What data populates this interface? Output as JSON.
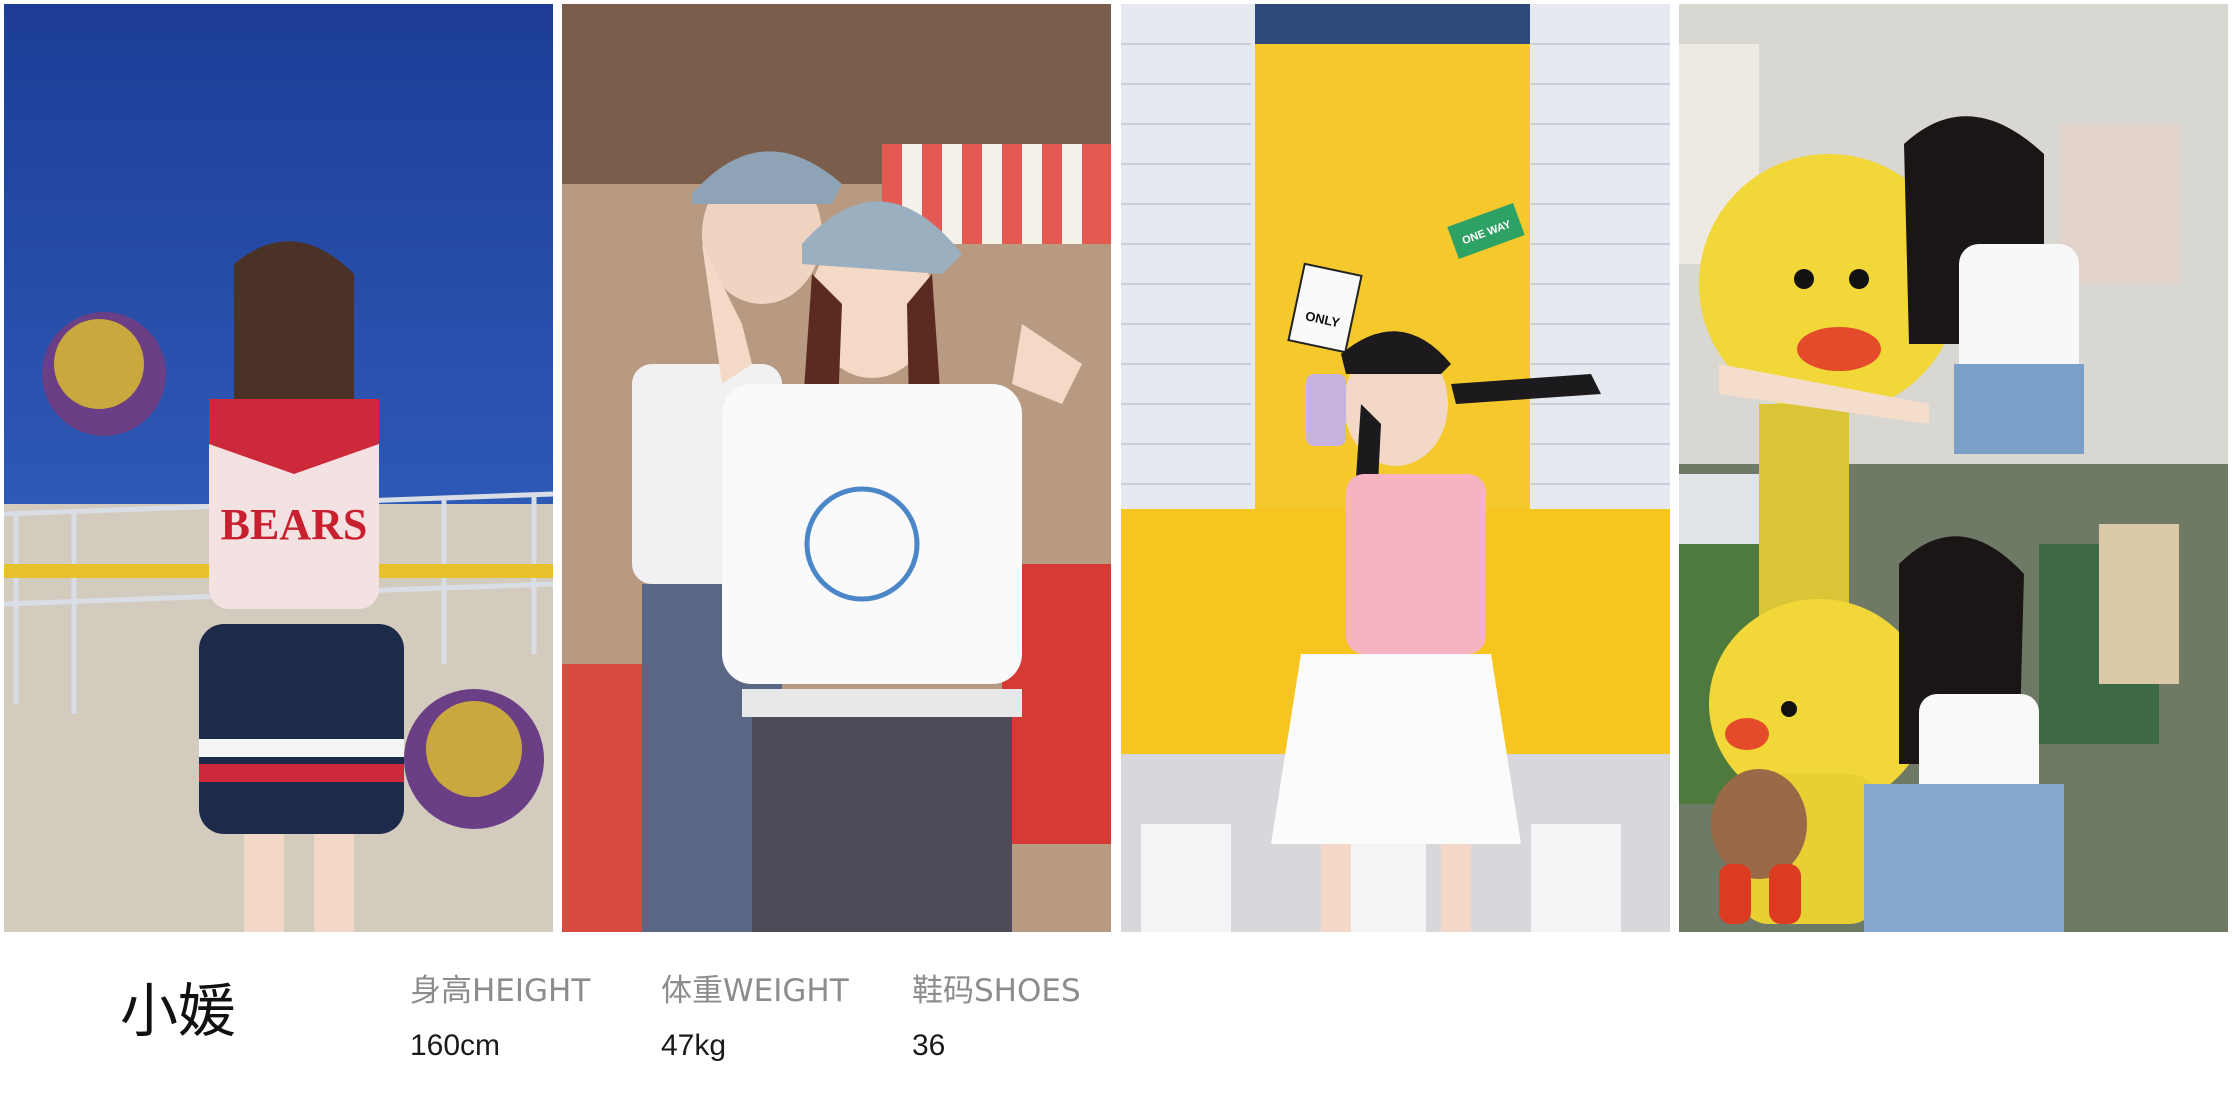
{
  "profile": {
    "name": "小媛",
    "stats": [
      {
        "label": "身高HEIGHT",
        "value": "160cm"
      },
      {
        "label": "体重WEIGHT",
        "value": "47kg"
      },
      {
        "label": "鞋码SHOES",
        "value": "36"
      }
    ]
  },
  "photos": [
    {
      "subject": "cheerleader-photo",
      "sign_text": "BEARS",
      "colors": {
        "sky": "#1f3f95",
        "ground": "#cfc6ba"
      }
    },
    {
      "subject": "street-dance-photo",
      "colors": {
        "bg": "#c9a88a",
        "accent": "#e05a4f"
      }
    },
    {
      "subject": "yellow-wall-photo",
      "sign_text": "ONLY",
      "sign_text_2": "ONE WAY",
      "colors": {
        "wall": "#f4c62a",
        "top": "#e9dfa0"
      }
    },
    {
      "subject": "duck-statue-photo",
      "colors": {
        "duck": "#f1d737",
        "beak": "#e34b2a"
      }
    }
  ]
}
